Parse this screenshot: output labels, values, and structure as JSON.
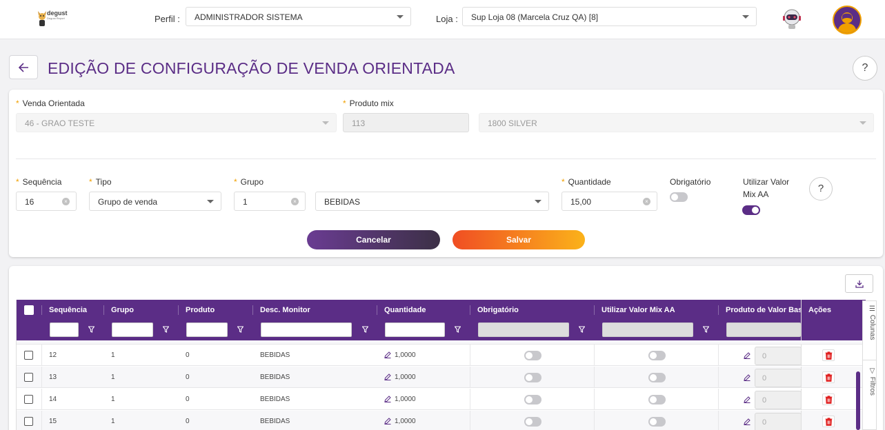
{
  "topbar": {
    "logo_text": "degust",
    "logo_sub": "Degust Report",
    "perfil_label": "Perfil :",
    "perfil_value": "ADMINISTRADOR SISTEMA",
    "loja_label": "Loja :",
    "loja_value": "Sup Loja 08 (Marcela Cruz QA) [8]"
  },
  "page": {
    "title": "EDIÇÃO DE CONFIGURAÇÃO DE VENDA ORIENTADA",
    "help": "?"
  },
  "form": {
    "venda_orientada_label": "Venda Orientada",
    "venda_orientada_value": "46 - GRAO TESTE",
    "produto_mix_label": "Produto mix",
    "produto_mix_code": "113",
    "produto_mix_desc": "1800 SILVER",
    "sequencia_label": "Sequência",
    "sequencia_value": "16",
    "tipo_label": "Tipo",
    "tipo_value": "Grupo de venda",
    "grupo_label": "Grupo",
    "grupo_code": "1",
    "grupo_desc": "BEBIDAS",
    "quantidade_label": "Quantidade",
    "quantidade_value": "15,00",
    "obrigatorio_label": "Obrigatório",
    "obrigatorio_on": false,
    "utilizar_label_1": "Utilizar Valor",
    "utilizar_label_2": "Mix AA",
    "utilizar_on": true,
    "help": "?",
    "cancel_label": "Cancelar",
    "save_label": "Salvar"
  },
  "grid": {
    "columns": [
      "Sequência",
      "Grupo",
      "Produto",
      "Desc. Monitor",
      "Quantidade",
      "Obrigatório",
      "Utilizar Valor Mix AA",
      "Produto de Valor Base",
      "Ações"
    ],
    "rows": [
      {
        "sequencia": "12",
        "grupo": "1",
        "produto": "0",
        "desc": "BEBIDAS",
        "quantidade": "1,0000",
        "base": "0"
      },
      {
        "sequencia": "13",
        "grupo": "1",
        "produto": "0",
        "desc": "BEBIDAS",
        "quantidade": "1,0000",
        "base": "0"
      },
      {
        "sequencia": "14",
        "grupo": "1",
        "produto": "0",
        "desc": "BEBIDAS",
        "quantidade": "1,0000",
        "base": "0"
      },
      {
        "sequencia": "15",
        "grupo": "1",
        "produto": "0",
        "desc": "BEBIDAS",
        "quantidade": "1,0000",
        "base": "0"
      }
    ],
    "side_colunas": "Colunas",
    "side_filtros": "Filtros"
  },
  "colors": {
    "primary": "#5b2d86",
    "accent_orange": "#f04e23",
    "accent_yellow": "#fbb21a",
    "required": "#f0a000",
    "delete": "#e02020"
  }
}
